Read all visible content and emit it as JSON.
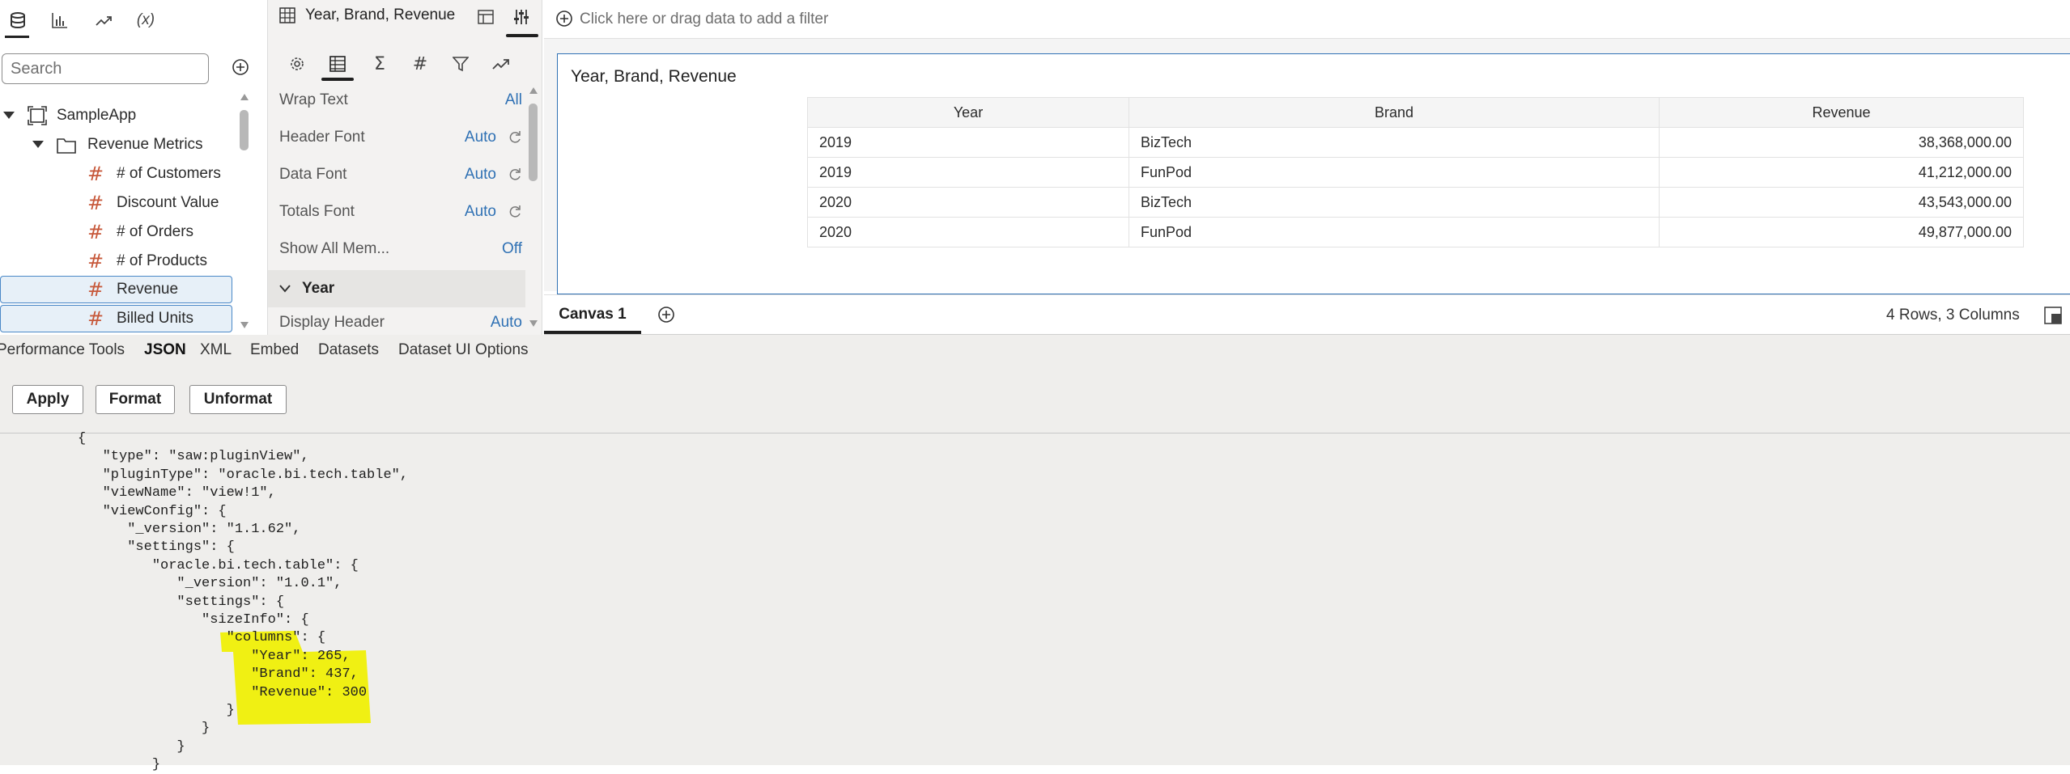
{
  "left_panel": {
    "tabs": [
      {
        "name": "data-tab",
        "icon": "database-icon"
      },
      {
        "name": "visualizations-tab",
        "icon": "bar-chart-icon"
      },
      {
        "name": "analytics-tab",
        "icon": "trend-icon"
      },
      {
        "name": "calculations-tab",
        "label": "(x)"
      }
    ],
    "search_placeholder": "Search",
    "tree": {
      "root": "SampleApp",
      "folder": "Revenue Metrics",
      "items": [
        "# of Customers",
        "Discount Value",
        "# of Orders",
        "# of Products",
        "Revenue",
        "Billed Units"
      ],
      "selected": [
        "Revenue",
        "Billed Units"
      ]
    }
  },
  "props_panel": {
    "title": "Year, Brand, Revenue",
    "rows": [
      {
        "label": "Wrap Text",
        "value": "All",
        "reset": false
      },
      {
        "label": "Header Font",
        "value": "Auto",
        "reset": true
      },
      {
        "label": "Data Font",
        "value": "Auto",
        "reset": true
      },
      {
        "label": "Totals Font",
        "value": "Auto",
        "reset": true
      },
      {
        "label": "Show All Mem...",
        "value": "Off",
        "reset": false
      }
    ],
    "section": "Year",
    "section_row": {
      "label": "Display Header",
      "value": "Auto"
    }
  },
  "filter_bar": {
    "placeholder": "Click here or drag data to add a filter"
  },
  "viz": {
    "title": "Year, Brand, Revenue",
    "columns": [
      "Year",
      "Brand",
      "Revenue"
    ],
    "rows": [
      [
        "2019",
        "BizTech",
        "38,368,000.00"
      ],
      [
        "2019",
        "FunPod",
        "41,212,000.00"
      ],
      [
        "2020",
        "BizTech",
        "43,543,000.00"
      ],
      [
        "2020",
        "FunPod",
        "49,877,000.00"
      ]
    ]
  },
  "canvas_tabs": {
    "active": "Canvas 1",
    "status": "4 Rows, 3 Columns"
  },
  "dev_panel": {
    "tabs": [
      "Performance Tools",
      "JSON",
      "XML",
      "Embed",
      "Datasets",
      "Dataset UI Options"
    ],
    "active_tab": "JSON",
    "buttons": {
      "apply": "Apply",
      "format": "Format",
      "unformat": "Unformat"
    },
    "code_lines": [
      "{",
      "   \"type\": \"saw:pluginView\",",
      "   \"pluginType\": \"oracle.bi.tech.table\",",
      "   \"viewName\": \"view!1\",",
      "   \"viewConfig\": {",
      "      \"_version\": \"1.1.62\",",
      "      \"settings\": {",
      "         \"oracle.bi.tech.table\": {",
      "            \"_version\": \"1.0.1\",",
      "            \"settings\": {",
      "               \"sizeInfo\": {",
      "                  \"columns\": {",
      "                     \"Year\": 265,",
      "                     \"Brand\": 437,",
      "                     \"Revenue\": 300",
      "                  }",
      "               }",
      "            }",
      "         }"
    ],
    "highlight_lines": [
      11,
      12,
      13,
      14
    ],
    "highlight_color": "#f0f000"
  },
  "colors": {
    "accent_blue": "#2f71b4",
    "measure_hash": "#c7583a"
  }
}
